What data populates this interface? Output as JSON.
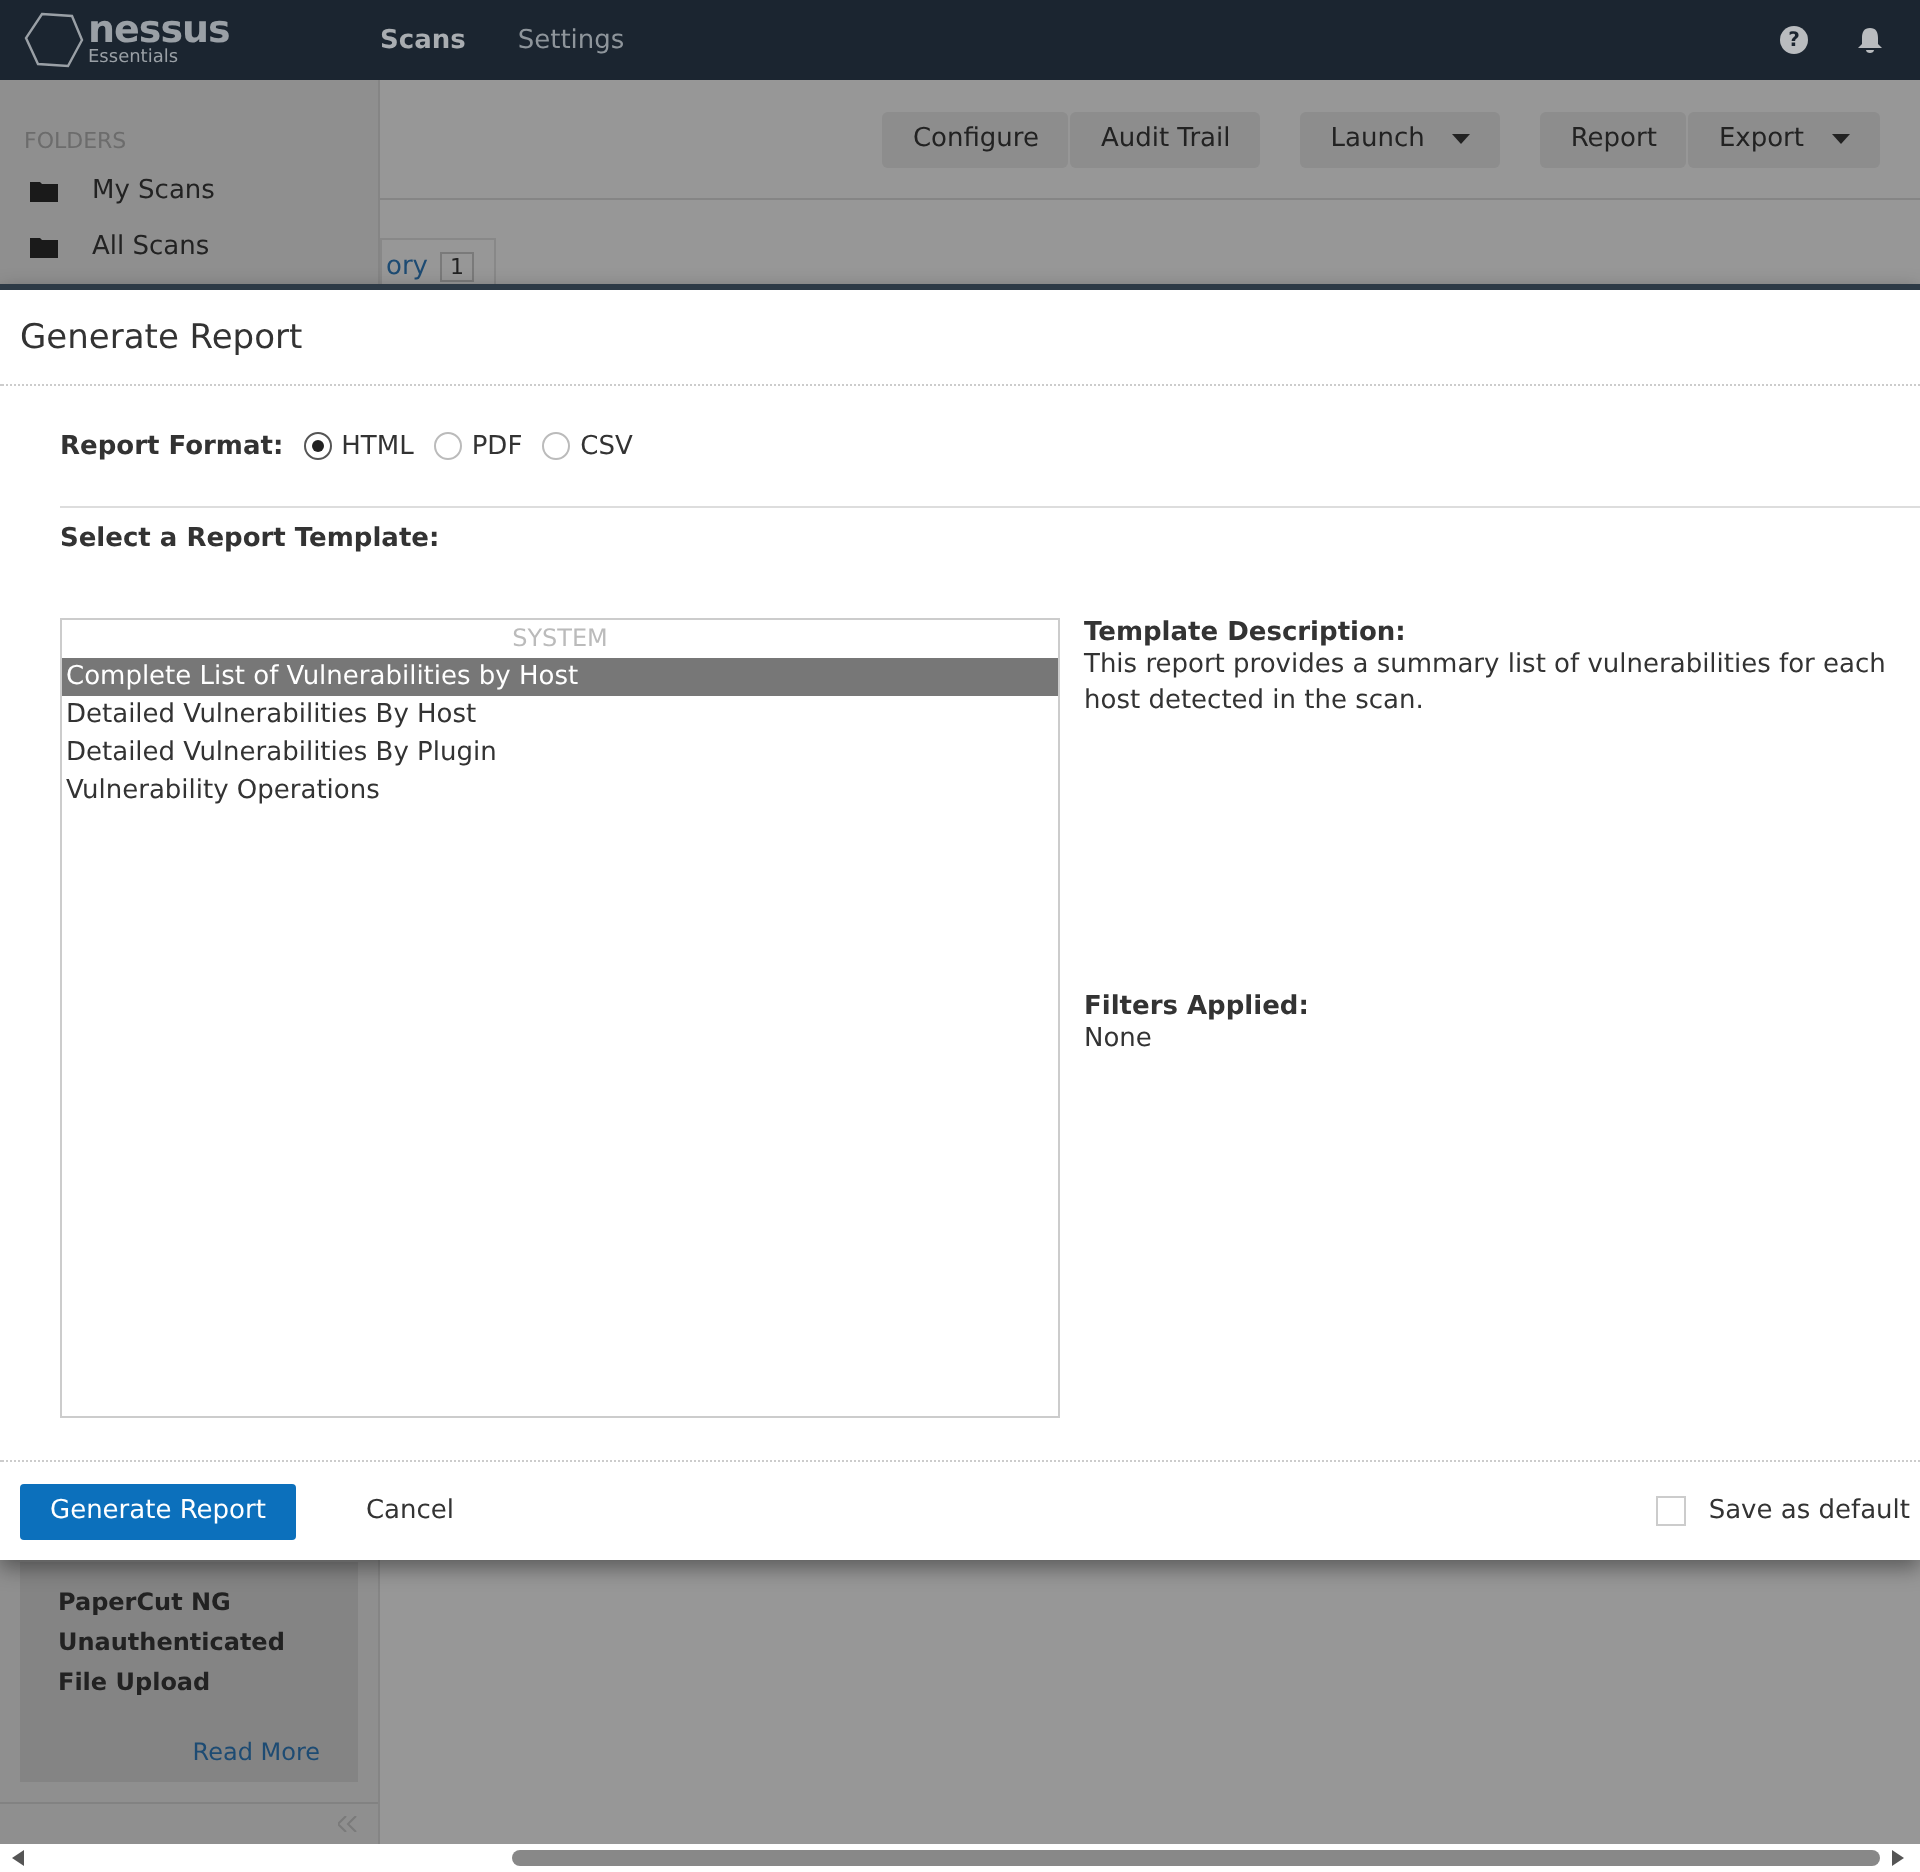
{
  "nav": {
    "logo": "nessus",
    "logo_sub": "Essentials",
    "items": [
      {
        "label": "Scans",
        "selected": true
      },
      {
        "label": "Settings",
        "selected": false
      }
    ],
    "help": "?"
  },
  "sidebar": {
    "heading": "FOLDERS",
    "items": [
      {
        "label": "My Scans"
      },
      {
        "label": "All Scans"
      }
    ],
    "card": {
      "title": "PaperCut NG Unauthenticated File Upload",
      "link": "Read More"
    }
  },
  "toolbar": {
    "groups": [
      [
        {
          "label": "Configure",
          "dropdown": false
        },
        {
          "label": "Audit Trail",
          "dropdown": false
        }
      ],
      [
        {
          "label": "Launch",
          "dropdown": true
        }
      ],
      [
        {
          "label": "Report",
          "dropdown": false
        },
        {
          "label": "Export",
          "dropdown": true
        }
      ]
    ]
  },
  "tabs": [
    {
      "label": "ory",
      "count": "1"
    }
  ],
  "dialog": {
    "title": "Generate Report",
    "format_label": "Report Format:",
    "formats": [
      {
        "label": "HTML",
        "selected": true
      },
      {
        "label": "PDF",
        "selected": false
      },
      {
        "label": "CSV",
        "selected": false
      }
    ],
    "template_label": "Select a Report Template:",
    "list_heading": "SYSTEM",
    "templates": [
      {
        "label": "Complete List of Vulnerabilities by Host",
        "selected": true
      },
      {
        "label": "Detailed Vulnerabilities By Host",
        "selected": false
      },
      {
        "label": "Detailed Vulnerabilities By Plugin",
        "selected": false
      },
      {
        "label": "Vulnerability Operations",
        "selected": false
      }
    ],
    "description_label": "Template Description:",
    "description": "This report provides a summary list of vulnerabilities for each host detected in the scan.",
    "filters_label": "Filters Applied:",
    "filters": "None",
    "primary_button": "Generate Report",
    "cancel_button": "Cancel",
    "save_default": {
      "label": "Save as default",
      "checked": false
    }
  }
}
